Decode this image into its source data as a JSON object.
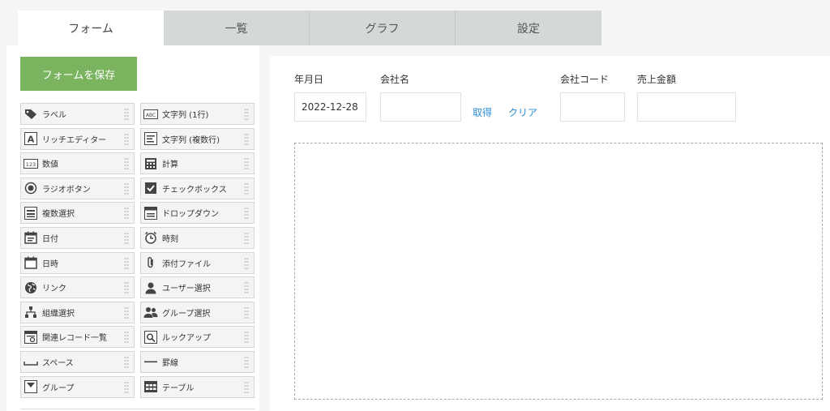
{
  "tabs": [
    {
      "label": "フォーム",
      "active": true
    },
    {
      "label": "一覧",
      "active": false
    },
    {
      "label": "グラフ",
      "active": false
    },
    {
      "label": "設定",
      "active": false
    }
  ],
  "save_button": {
    "label": "フォームを保存",
    "color": "#7bb45f"
  },
  "palette": [
    {
      "label": "ラベル",
      "icon": "tag-icon"
    },
    {
      "label": "文字列 (1行)",
      "icon": "abc-text-icon"
    },
    {
      "label": "リッチエディター",
      "icon": "rich-editor-icon"
    },
    {
      "label": "文字列 (複数行)",
      "icon": "multiline-text-icon"
    },
    {
      "label": "数値",
      "icon": "number-icon"
    },
    {
      "label": "計算",
      "icon": "calculator-icon"
    },
    {
      "label": "ラジオボタン",
      "icon": "radio-icon"
    },
    {
      "label": "チェックボックス",
      "icon": "checkbox-icon"
    },
    {
      "label": "複数選択",
      "icon": "multi-select-icon"
    },
    {
      "label": "ドロップダウン",
      "icon": "dropdown-icon"
    },
    {
      "label": "日付",
      "icon": "date-icon"
    },
    {
      "label": "時刻",
      "icon": "clock-icon"
    },
    {
      "label": "日時",
      "icon": "datetime-icon"
    },
    {
      "label": "添付ファイル",
      "icon": "paperclip-icon"
    },
    {
      "label": "リンク",
      "icon": "globe-icon"
    },
    {
      "label": "ユーザー選択",
      "icon": "user-icon"
    },
    {
      "label": "組織選択",
      "icon": "org-icon"
    },
    {
      "label": "グループ選択",
      "icon": "group-icon"
    },
    {
      "label": "関連レコード一覧",
      "icon": "related-records-icon"
    },
    {
      "label": "ルックアップ",
      "icon": "lookup-icon"
    },
    {
      "label": "スペース",
      "icon": "space-icon"
    },
    {
      "label": "罫線",
      "icon": "line-icon"
    },
    {
      "label": "グループ",
      "icon": "group-field-icon"
    },
    {
      "label": "テーブル",
      "icon": "table-icon"
    }
  ],
  "form": {
    "date_label": "年月日",
    "date_value": "2022-12-28",
    "company_label": "会社名",
    "company_value": "",
    "fetch_label": "取得",
    "clear_label": "クリア",
    "code_label": "会社コード",
    "code_value": "",
    "sales_label": "売上金額",
    "sales_value": ""
  },
  "colors": {
    "accent": "#7bb45f",
    "link": "#2d8fd5",
    "tab_inactive": "#d4d8d9"
  }
}
